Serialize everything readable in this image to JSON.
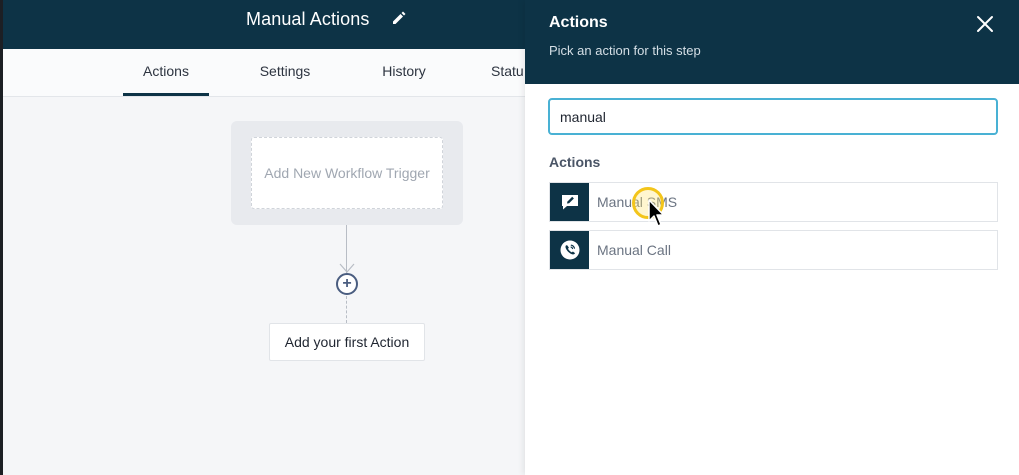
{
  "header": {
    "title": "Manual Actions"
  },
  "tabs": [
    {
      "label": "Actions",
      "active": true
    },
    {
      "label": "Settings",
      "active": false
    },
    {
      "label": "History",
      "active": false
    },
    {
      "label": "Statu",
      "active": false
    }
  ],
  "canvas": {
    "trigger_text": "Add New Workflow Trigger",
    "add_action_text": "Add your first Action"
  },
  "panel": {
    "title": "Actions",
    "subtitle": "Pick an action for this step",
    "search_value": "manual",
    "section_label": "Actions",
    "items": [
      {
        "label": "Manual SMS",
        "icon": "sms-icon"
      },
      {
        "label": "Manual Call",
        "icon": "phone-icon"
      }
    ]
  },
  "colors": {
    "brand_dark": "#0d3346",
    "input_focus": "#49b1d4",
    "cursor_highlight": "#f3c51b"
  }
}
